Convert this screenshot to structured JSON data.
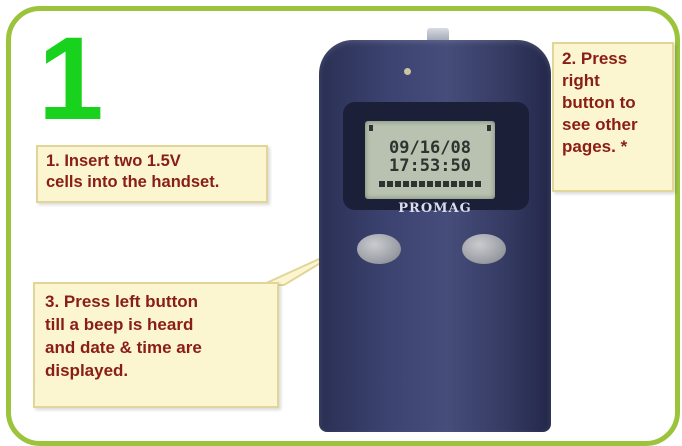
{
  "step": {
    "number": "1"
  },
  "device": {
    "brand": "PROMAG",
    "screen": {
      "date": "09/16/08",
      "time": "17:53:50"
    }
  },
  "callouts": {
    "insert": {
      "lines": [
        "1. Insert two 1.5V",
        "cells into the handset."
      ]
    },
    "right_button": {
      "lines": [
        "2. Press",
        "right",
        "button to",
        "see other",
        "pages. *"
      ]
    },
    "left_button": {
      "lines": [
        "3. Press left button",
        "till a beep is heard",
        "and date & time are",
        "displayed."
      ]
    }
  },
  "colors": {
    "frame": "#9bc33b",
    "step_number": "#19d21e",
    "callout_bg": "#fbf6cf",
    "callout_text": "#8a1d16",
    "device_body": "#3c4370"
  }
}
